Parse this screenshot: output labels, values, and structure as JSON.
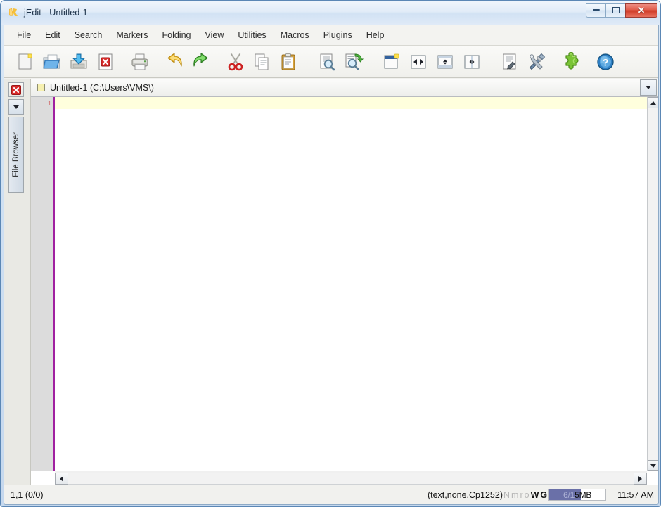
{
  "window": {
    "title": "jEdit - Untitled-1",
    "app_icon": "jedit-logo-icon",
    "controls": {
      "minimize_label": "—",
      "maximize_label": "□",
      "close_label": "✕"
    }
  },
  "menubar": {
    "items": [
      {
        "label": "File",
        "mnemonic": "F",
        "name": "menu-file"
      },
      {
        "label": "Edit",
        "mnemonic": "E",
        "name": "menu-edit"
      },
      {
        "label": "Search",
        "mnemonic": "S",
        "name": "menu-search"
      },
      {
        "label": "Markers",
        "mnemonic": "M",
        "name": "menu-markers"
      },
      {
        "label": "Folding",
        "mnemonic": "o",
        "name": "menu-folding"
      },
      {
        "label": "View",
        "mnemonic": "V",
        "name": "menu-view"
      },
      {
        "label": "Utilities",
        "mnemonic": "U",
        "name": "menu-utilities"
      },
      {
        "label": "Macros",
        "mnemonic": "c",
        "name": "menu-macros"
      },
      {
        "label": "Plugins",
        "mnemonic": "P",
        "name": "menu-plugins"
      },
      {
        "label": "Help",
        "mnemonic": "H",
        "name": "menu-help"
      }
    ]
  },
  "toolbar": {
    "buttons": [
      {
        "name": "new-file-icon",
        "tooltip": "New File"
      },
      {
        "name": "open-file-icon",
        "tooltip": "Open File"
      },
      {
        "name": "save-file-icon",
        "tooltip": "Save"
      },
      {
        "name": "close-file-icon",
        "tooltip": "Close File"
      },
      {
        "name": "print-icon",
        "tooltip": "Print"
      },
      {
        "name": "undo-icon",
        "tooltip": "Undo"
      },
      {
        "name": "redo-icon",
        "tooltip": "Redo"
      },
      {
        "name": "cut-icon",
        "tooltip": "Cut"
      },
      {
        "name": "copy-icon",
        "tooltip": "Copy"
      },
      {
        "name": "paste-icon",
        "tooltip": "Paste"
      },
      {
        "name": "find-icon",
        "tooltip": "Find"
      },
      {
        "name": "find-next-icon",
        "tooltip": "Find Next"
      },
      {
        "name": "new-view-icon",
        "tooltip": "New View"
      },
      {
        "name": "unsplit-icon",
        "tooltip": "Unsplit"
      },
      {
        "name": "split-horizontal-icon",
        "tooltip": "Split Horizontally"
      },
      {
        "name": "split-vertical-icon",
        "tooltip": "Split Vertically"
      },
      {
        "name": "current-buffer-icon",
        "tooltip": "Buffer Options"
      },
      {
        "name": "global-options-icon",
        "tooltip": "Global Options"
      },
      {
        "name": "plugin-manager-icon",
        "tooltip": "Plugin Manager"
      },
      {
        "name": "help-icon",
        "tooltip": "Help"
      }
    ]
  },
  "left_dock": {
    "close_label": "✕",
    "menu_label": "▼",
    "tab_label": "File Browser"
  },
  "buffer_strip": {
    "swatch_color": "#f6f0b0",
    "label": "Untitled-1 (C:\\Users\\VMS\\)",
    "dropdown_label": "▼"
  },
  "editor": {
    "gutter_line_number": "1",
    "gutter_number_color": "#d16a6a",
    "gutter_bg": "#dcdcdc",
    "gutter_border_color": "#a020a0",
    "caret_line_color": "#ffffdd",
    "wrap_guide_color": "#b0b8e0",
    "background": "#ffffff",
    "content": ""
  },
  "scrollbars": {
    "v_up": "▲",
    "v_down": "▼",
    "h_left": "◀",
    "h_right": "▶"
  },
  "statusbar": {
    "caret_position": "1,1 (0/0)",
    "mode_encoding": "(text,none,Cp1252)",
    "flags": [
      {
        "label": "N",
        "state": "off",
        "name": "status-flag-wrap"
      },
      {
        "label": "m",
        "state": "off",
        "name": "status-flag-multiselect"
      },
      {
        "label": "r",
        "state": "off",
        "name": "status-flag-rectselect"
      },
      {
        "label": "o",
        "state": "off",
        "name": "status-flag-overwrite"
      },
      {
        "label": "W",
        "state": "on",
        "name": "status-flag-linesep"
      },
      {
        "label": "G",
        "state": "on",
        "name": "status-flag-foldmode"
      }
    ],
    "memory": {
      "used": "6",
      "total": "15MB",
      "text": "6/15MB",
      "fill_percent": 56,
      "fill_color": "#6a70a8"
    },
    "clock": "11:57 AM"
  }
}
